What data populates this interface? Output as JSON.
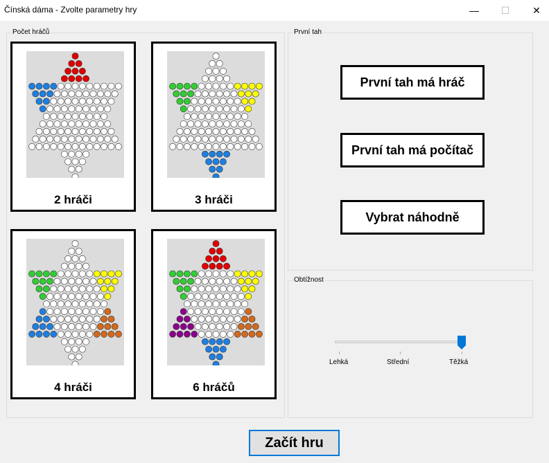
{
  "window": {
    "title": "Čínská dáma - Zvolte parametry hry",
    "minimize": "—",
    "maximize": "☐",
    "close": "✕"
  },
  "players_group": {
    "label": "Počet hráčů",
    "options": [
      {
        "label": "2 hráči",
        "corners": [
          "red",
          "",
          "",
          "",
          "",
          "blue"
        ]
      },
      {
        "label": "3 hráči",
        "corners": [
          "",
          "yellow",
          "",
          "blue",
          "",
          "green"
        ]
      },
      {
        "label": "4 hráči",
        "corners": [
          "",
          "yellow",
          "orange",
          "",
          "blue",
          "green"
        ]
      },
      {
        "label": "6 hráčů",
        "corners": [
          "red",
          "yellow",
          "orange",
          "blue",
          "purple",
          "green"
        ]
      }
    ]
  },
  "first_move_group": {
    "label": "První tah",
    "buttons": [
      "První tah má hráč",
      "První tah má počítač",
      "Vybrat náhodně"
    ]
  },
  "difficulty_group": {
    "label": "Obtížnost",
    "levels": [
      "Lehká",
      "Střední",
      "Těžká"
    ],
    "selected_index": 2
  },
  "start_button": "Začít hru",
  "colors": {
    "red": "#e00000",
    "yellow": "#ffff00",
    "orange": "#d2691e",
    "blue": "#1e7fe0",
    "purple": "#8b008b",
    "green": "#32cd32",
    "empty": "#ffffff",
    "board_bg": "#dcdcdc",
    "accent": "#0078d7"
  }
}
